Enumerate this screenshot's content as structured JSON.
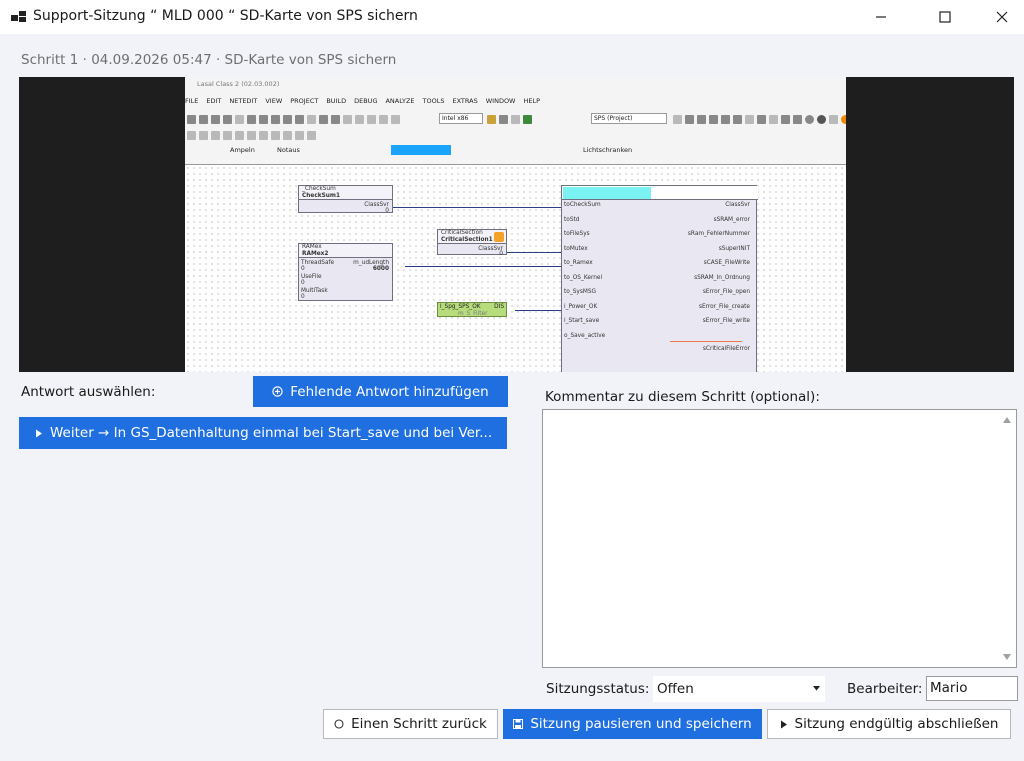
{
  "window": {
    "title": "Support-Sitzung “ MLD 000 “ SD-Karte von SPS sichern"
  },
  "step": {
    "header": "Schritt 1 · 04.09.2026 05:47 · SD-Karte von SPS sichern"
  },
  "screenshot": {
    "ide_title": "Lasal Class 2 (02.03.002)",
    "menu": [
      "FILE",
      "EDIT",
      "NETEDIT",
      "VIEW",
      "PROJECT",
      "BUILD",
      "DEBUG",
      "ANALYZE",
      "TOOLS",
      "EXTRAS",
      "WINDOW",
      "HELP"
    ],
    "platform_combo": "Intel x86",
    "project_combo": "SPS (Project)",
    "lib_items": [
      "Ampeln",
      "Notaus",
      "Lichtschranken"
    ],
    "blocks": {
      "checksum": {
        "type": "_CheckSum",
        "name": "CheckSum1",
        "pin": "ClassSvr",
        "val": "0"
      },
      "ramex": {
        "type": "RAMex",
        "name": "RAMex2",
        "pins": [
          "ThreadSafe",
          "UseFile",
          "MultiTask"
        ],
        "right_pin": "m_udLength",
        "right_val": "6000"
      },
      "critical": {
        "type": "CriticalSection",
        "name": "CriticalSection1",
        "pin": "ClassSvr",
        "val": "0"
      },
      "spsok": {
        "name": "l_Spg_SPS_OK",
        "tag": "DIS",
        "sub": "m_S_Filter"
      },
      "main_left": [
        "toCheckSum",
        "toStd",
        "toFileSys",
        "toMutex",
        "to_Ramex",
        "to_OS_Kernel",
        "to_SysMSG",
        "i_Power_OK",
        "i_Start_save",
        "o_Save_active"
      ],
      "main_right": [
        "ClassSvr",
        "sSRAM_error",
        "sRam_FehlerNummer",
        "sSuperINIT",
        "sCASE_FileWrite",
        "sSRAM_In_Ordnung",
        "sError_File_open",
        "sError_File_create",
        "sError_File_write",
        "sCriticalFileError"
      ]
    }
  },
  "answer": {
    "label": "Antwort auswählen:",
    "add_button": "Fehlende Antwort hinzufügen",
    "next_button": "Weiter → In GS_Datenhaltung einmal bei Start_save und bei Ver..."
  },
  "comment": {
    "label": "Kommentar zu diesem Schritt (optional):",
    "value": ""
  },
  "session": {
    "status_label": "Sitzungsstatus:",
    "status_value": "Offen",
    "editor_label": "Bearbeiter:",
    "editor_value": "Mario"
  },
  "buttons": {
    "back": "Einen Schritt zurück",
    "pause": "Sitzung pausieren und speichern",
    "finish": "Sitzung endgültig abschließen"
  },
  "colors": {
    "accent": "#1f6fe0",
    "background": "#f1f3f9"
  },
  "icons": {
    "app": "app-windows-icon",
    "minimize": "minimize-icon",
    "maximize": "maximize-icon",
    "close": "close-icon",
    "add": "plus-circle-icon",
    "next": "play-triangle-icon",
    "back": "circle-icon",
    "pause": "save-disk-icon",
    "finish": "play-triangle-icon",
    "dropdown": "dropdown-arrow-icon"
  }
}
